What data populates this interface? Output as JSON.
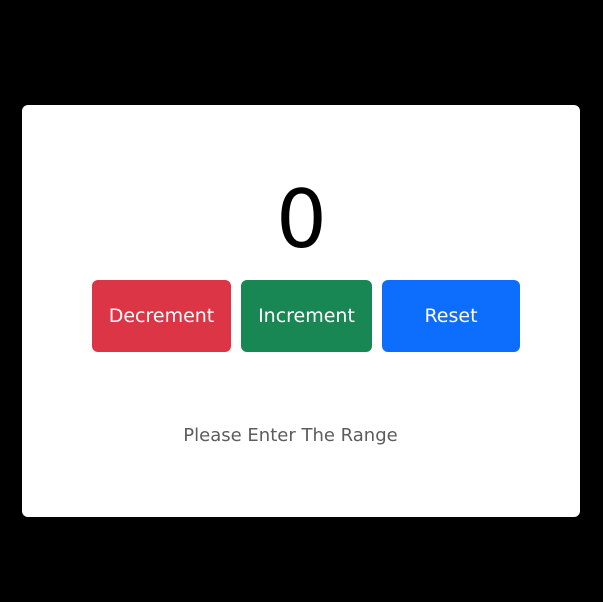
{
  "counter": {
    "value": "0"
  },
  "buttons": {
    "decrement_label": "Decrement",
    "increment_label": "Increment",
    "reset_label": "Reset"
  },
  "message": {
    "text": "Please Enter The Range"
  },
  "colors": {
    "background": "#000000",
    "card": "#ffffff",
    "decrement": "#dc3545",
    "increment": "#198754",
    "reset": "#0d6efd",
    "message_text": "#5c5c5c"
  }
}
